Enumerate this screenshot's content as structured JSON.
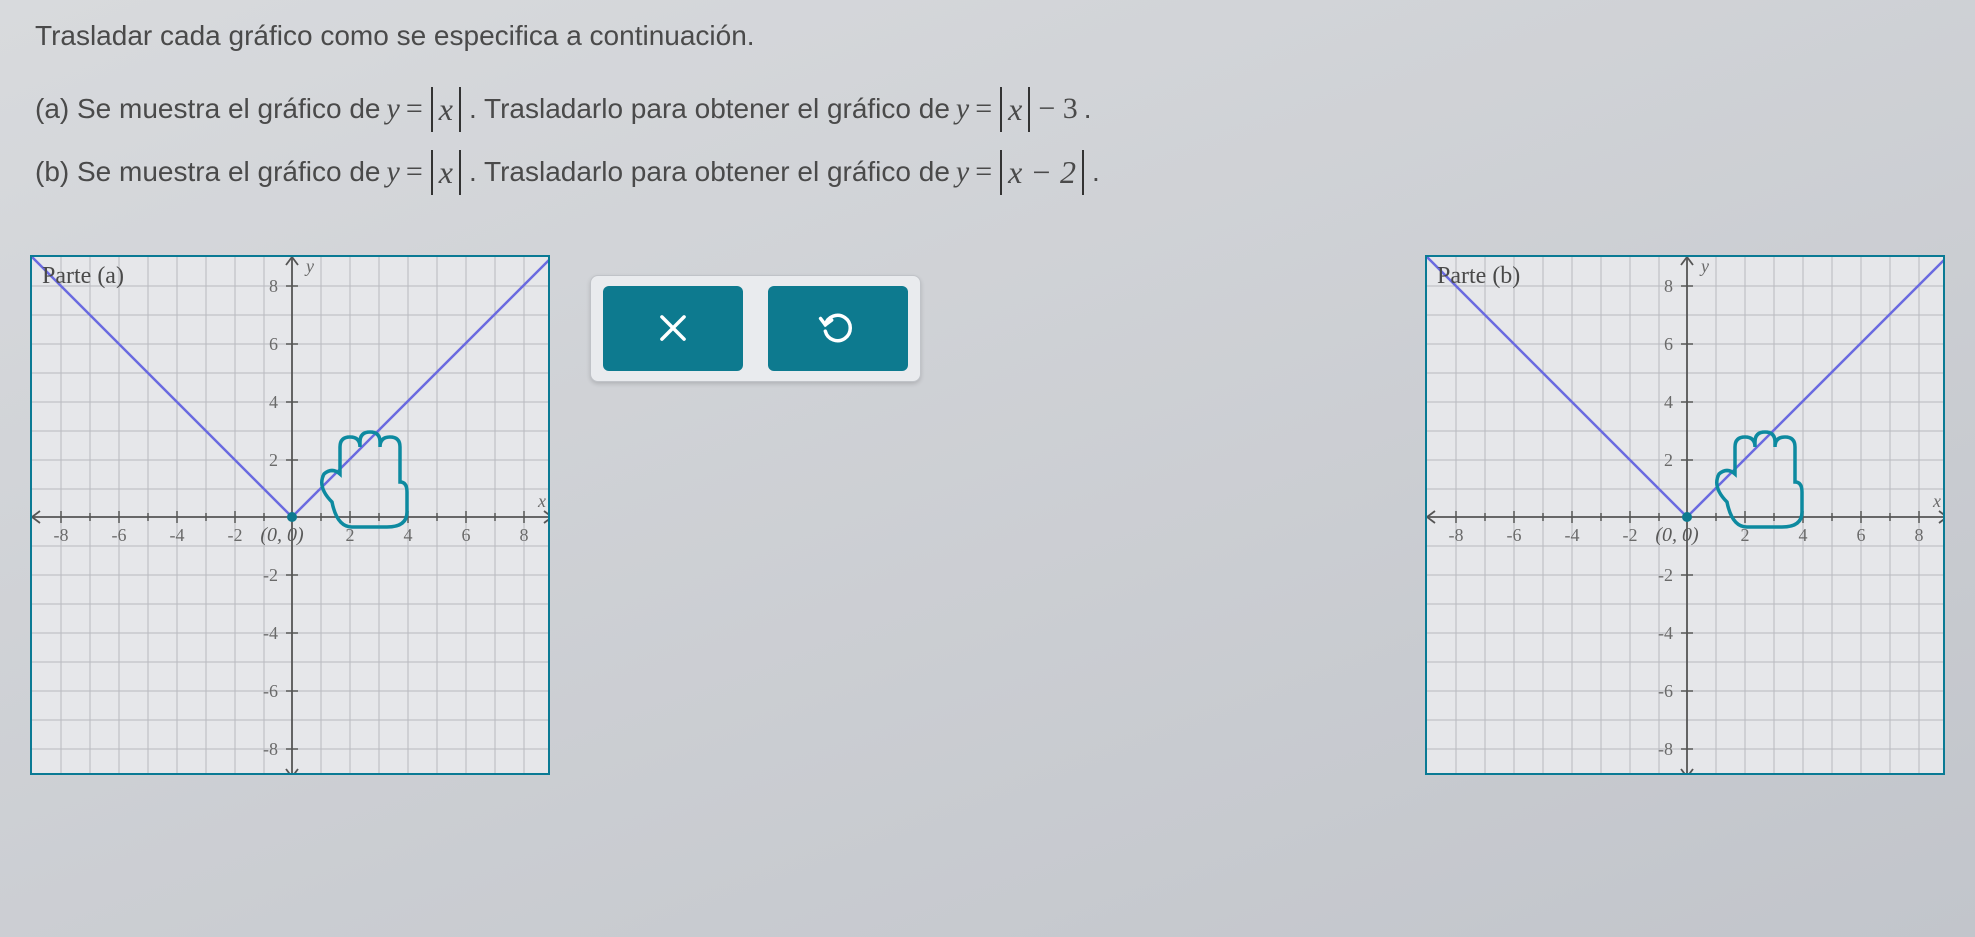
{
  "instructions": {
    "main": "Trasladar cada gráfico como se especifica a continuación.",
    "a_prefix": "(a) Se muestra el gráfico de",
    "a_mid": ". Trasladarlo para obtener el gráfico de",
    "a_end": ".",
    "b_prefix": "(b) Se muestra el gráfico de",
    "b_mid": ". Trasladarlo para obtener el gráfico de",
    "b_end": ".",
    "eq_base_lhs": "y",
    "eq_equals": "=",
    "eq_base_rhs": "x",
    "eq_a_target": "− 3",
    "eq_b_target_inside": "x − 2"
  },
  "buttons": {
    "clear": "×",
    "reset": "↺"
  },
  "graph_a": {
    "label": "Parte (a)",
    "vertex_label": "(0, 0)"
  },
  "graph_b": {
    "label": "Parte (b)",
    "vertex_label": "(0, 0)"
  },
  "chart_data": [
    {
      "type": "line",
      "title": "Parte (a)",
      "xlabel": "x",
      "ylabel": "y",
      "xlim": [
        -9,
        9
      ],
      "ylim": [
        -9,
        9
      ],
      "x_ticks": [
        -8,
        -6,
        -4,
        -2,
        0,
        2,
        4,
        6,
        8
      ],
      "y_ticks": [
        -8,
        -6,
        -4,
        -2,
        0,
        2,
        4,
        6,
        8
      ],
      "series": [
        {
          "name": "y = |x|",
          "x": [
            -9,
            -8,
            -6,
            -4,
            -2,
            0,
            2,
            4,
            6,
            8,
            9
          ],
          "y": [
            9,
            8,
            6,
            4,
            2,
            0,
            2,
            4,
            6,
            8,
            9
          ]
        }
      ],
      "vertex": {
        "x": 0,
        "y": 0,
        "label": "(0, 0)"
      },
      "target_transform": "y = |x| - 3 (shift down 3)"
    },
    {
      "type": "line",
      "title": "Parte (b)",
      "xlabel": "x",
      "ylabel": "y",
      "xlim": [
        -9,
        9
      ],
      "ylim": [
        -9,
        9
      ],
      "x_ticks": [
        -8,
        -6,
        -4,
        -2,
        0,
        2,
        4,
        6,
        8
      ],
      "y_ticks": [
        -8,
        -6,
        -4,
        -2,
        0,
        2,
        4,
        6,
        8
      ],
      "series": [
        {
          "name": "y = |x|",
          "x": [
            -9,
            -8,
            -6,
            -4,
            -2,
            0,
            2,
            4,
            6,
            8,
            9
          ],
          "y": [
            9,
            8,
            6,
            4,
            2,
            0,
            2,
            4,
            6,
            8,
            9
          ]
        }
      ],
      "vertex": {
        "x": 0,
        "y": 0,
        "label": "(0, 0)"
      },
      "target_transform": "y = |x - 2| (shift right 2)"
    }
  ]
}
